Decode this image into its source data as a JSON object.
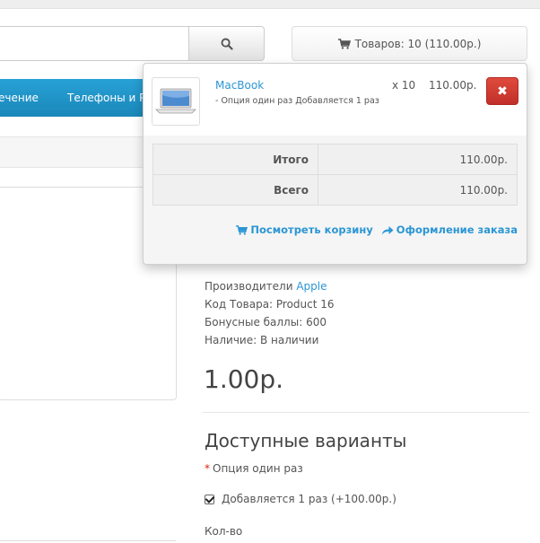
{
  "search": {
    "value": "",
    "placeholder": ""
  },
  "cart_button": {
    "label": "Товаров: 10 (110.00р.)"
  },
  "menu": {
    "items": [
      "ечение",
      "Телефоны и PDA"
    ]
  },
  "product_info": {
    "manufacturer_label": "Производители",
    "manufacturer": "Apple",
    "code": "Код Товара: Product 16",
    "bonus": "Бонусные баллы: 600",
    "availability": "Наличие: В наличии"
  },
  "price": "1.00р.",
  "options": {
    "title": "Доступные варианты",
    "required_label": "Опция один раз",
    "checkbox_label": "Добавляется 1 раз (+100.00р.)",
    "checked": true
  },
  "qty_label": "Кол-во",
  "cart_dropdown": {
    "item": {
      "name": "MacBook",
      "option": "- Опция один раз Добавляется 1 раз",
      "qty": "x 10",
      "price": "110.00р."
    },
    "totals": [
      {
        "label": "Итого",
        "value": "110.00р."
      },
      {
        "label": "Всего",
        "value": "110.00р."
      }
    ],
    "view_cart": "Посмотреть корзину",
    "checkout": "Оформление заказа"
  },
  "colors": {
    "link": "#2a96d4",
    "menu": "#229ad2",
    "remove": "#d0392e"
  }
}
